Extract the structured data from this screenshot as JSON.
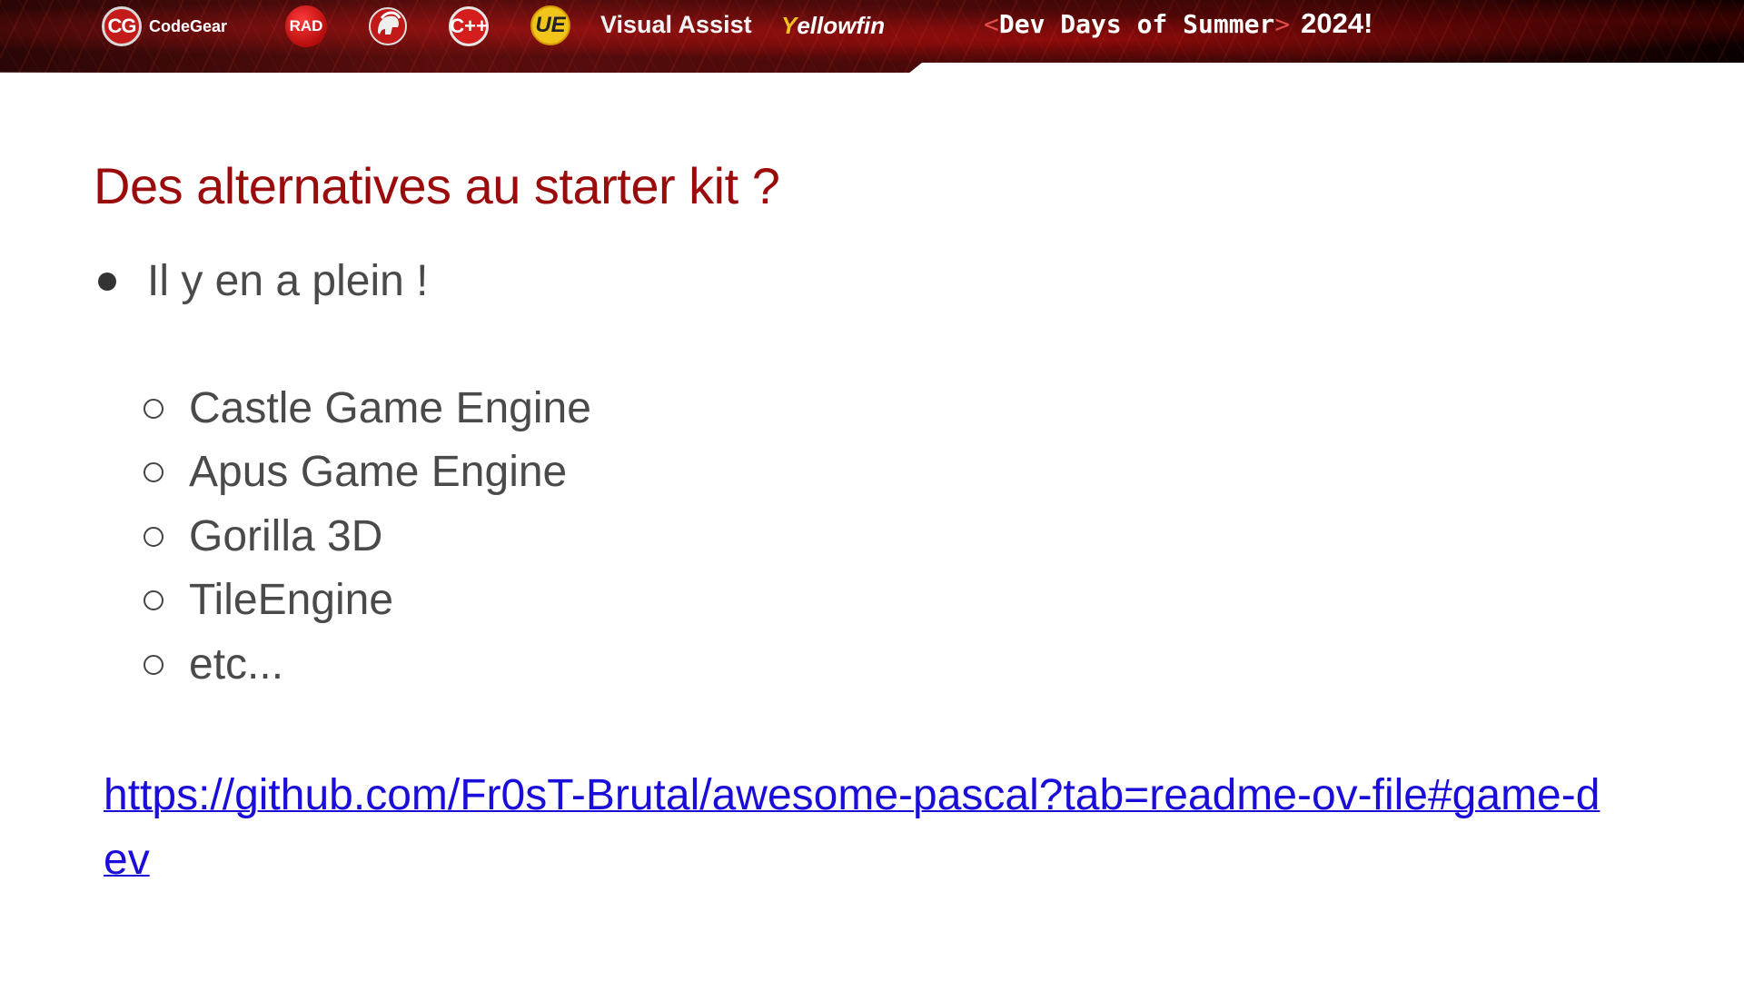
{
  "banner": {
    "logos": {
      "codegear_mark": "CG",
      "codegear_name": "CodeGear",
      "rad": "RAD",
      "cpp": "C++",
      "ue": "UE",
      "visual_assist": "Visual Assist",
      "yellowfin_y": "Y",
      "yellowfin_rest": "ellowfin"
    },
    "event": {
      "open": "<",
      "name": "Dev Days of Summer",
      "close": ">",
      "year": "2024!"
    },
    "colors": {
      "accent": "#e34b4b",
      "ue_yellow": "#f0c419",
      "yellowfin_yellow": "#f1c21b"
    }
  },
  "slide": {
    "title": "Des alternatives au starter kit ?",
    "title_color": "#9b0b0b",
    "bullet": "Il y en a plein !",
    "items": [
      "Castle Game Engine",
      "Apus Game Engine",
      "Gorilla 3D",
      "TileEngine",
      "etc..."
    ],
    "link": "https://github.com/Fr0sT-Brutal/awesome-pascal?tab=readme-ov-file#game-dev",
    "link_color": "#1a0dd9"
  }
}
